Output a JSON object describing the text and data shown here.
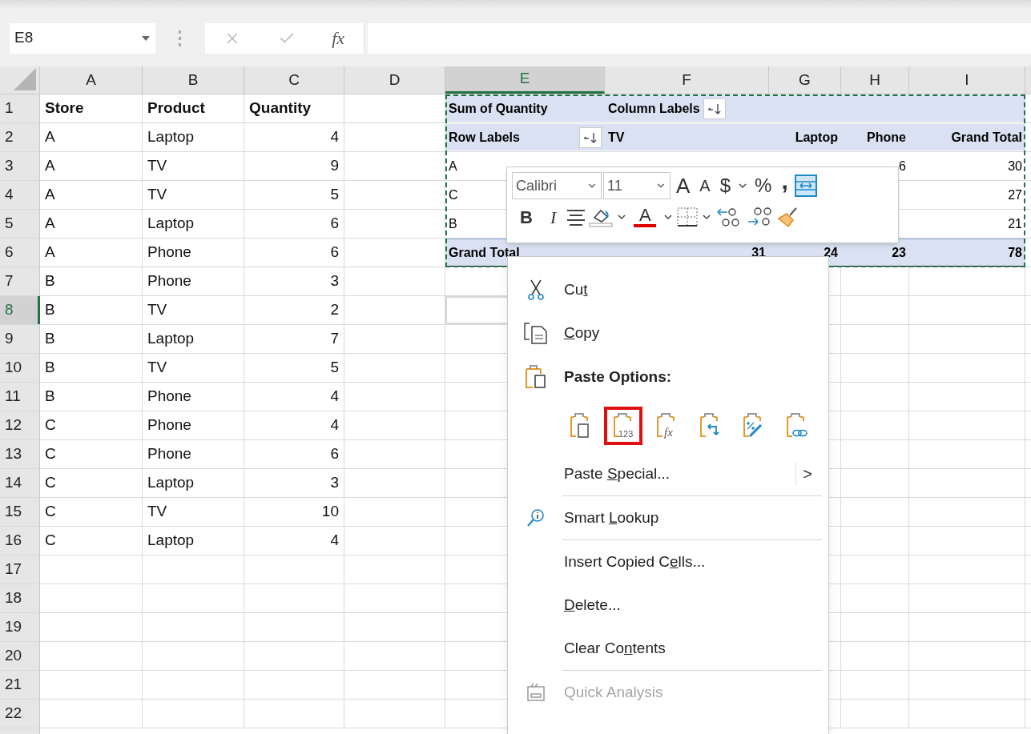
{
  "formula_bar": {
    "name_box": "E8",
    "fx": "fx"
  },
  "columns": [
    {
      "label": "A",
      "selected": false
    },
    {
      "label": "B",
      "selected": false
    },
    {
      "label": "C",
      "selected": false
    },
    {
      "label": "D",
      "selected": false
    },
    {
      "label": "E",
      "selected": true
    },
    {
      "label": "F",
      "selected": false
    },
    {
      "label": "G",
      "selected": false
    },
    {
      "label": "H",
      "selected": false
    },
    {
      "label": "I",
      "selected": false
    }
  ],
  "rows": [
    {
      "number": "1",
      "kind": "header",
      "selected": false,
      "cells": [
        "Store",
        "Product",
        "Quantity"
      ]
    },
    {
      "number": "2",
      "kind": "data",
      "selected": false,
      "cells": [
        "A",
        "Laptop",
        "4"
      ]
    },
    {
      "number": "3",
      "kind": "data",
      "selected": false,
      "cells": [
        "A",
        "TV",
        "9"
      ]
    },
    {
      "number": "4",
      "kind": "data",
      "selected": false,
      "cells": [
        "A",
        "TV",
        "5"
      ]
    },
    {
      "number": "5",
      "kind": "data",
      "selected": false,
      "cells": [
        "A",
        "Laptop",
        "6"
      ]
    },
    {
      "number": "6",
      "kind": "data",
      "selected": false,
      "cells": [
        "A",
        "Phone",
        "6"
      ]
    },
    {
      "number": "7",
      "kind": "data",
      "selected": false,
      "cells": [
        "B",
        "Phone",
        "3"
      ]
    },
    {
      "number": "8",
      "kind": "data",
      "selected": true,
      "cells": [
        "B",
        "TV",
        "2"
      ]
    },
    {
      "number": "9",
      "kind": "data",
      "selected": false,
      "cells": [
        "B",
        "Laptop",
        "7"
      ]
    },
    {
      "number": "10",
      "kind": "data",
      "selected": false,
      "cells": [
        "B",
        "TV",
        "5"
      ]
    },
    {
      "number": "11",
      "kind": "data",
      "selected": false,
      "cells": [
        "B",
        "Phone",
        "4"
      ]
    },
    {
      "number": "12",
      "kind": "data",
      "selected": false,
      "cells": [
        "C",
        "Phone",
        "4"
      ]
    },
    {
      "number": "13",
      "kind": "data",
      "selected": false,
      "cells": [
        "C",
        "Phone",
        "6"
      ]
    },
    {
      "number": "14",
      "kind": "data",
      "selected": false,
      "cells": [
        "C",
        "Laptop",
        "3"
      ]
    },
    {
      "number": "15",
      "kind": "data",
      "selected": false,
      "cells": [
        "C",
        "TV",
        "10"
      ]
    },
    {
      "number": "16",
      "kind": "data",
      "selected": false,
      "cells": [
        "C",
        "Laptop",
        "4"
      ]
    },
    {
      "number": "17",
      "kind": "data",
      "selected": false,
      "cells": []
    },
    {
      "number": "18",
      "kind": "data",
      "selected": false,
      "cells": []
    },
    {
      "number": "19",
      "kind": "data",
      "selected": false,
      "cells": []
    },
    {
      "number": "20",
      "kind": "data",
      "selected": false,
      "cells": []
    },
    {
      "number": "21",
      "kind": "data",
      "selected": false,
      "cells": []
    },
    {
      "number": "22",
      "kind": "data",
      "selected": false,
      "cells": []
    }
  ],
  "pivot": {
    "value_label": "Sum of Quantity",
    "column_labels": "Column Labels",
    "row_labels": "Row Labels",
    "columns": [
      "TV",
      "Laptop",
      "Phone",
      "Grand Total"
    ],
    "rows": [
      {
        "label": "A",
        "phone": "6",
        "grand_total": "30"
      },
      {
        "label": "C",
        "grand_total": "27"
      },
      {
        "label": "B",
        "grand_total": "21"
      }
    ],
    "total": {
      "label": "Grand Total",
      "tv": "31",
      "laptop": "24",
      "phone": "23",
      "grand_total": "78"
    }
  },
  "mini_toolbar": {
    "font": "Calibri",
    "size": "11",
    "row_1": [
      {
        "kind": "grow",
        "glyph": "A"
      },
      {
        "kind": "shrink",
        "glyph": "A"
      },
      {
        "kind": "glyph",
        "glyph": "$"
      },
      {
        "kind": "caret"
      },
      {
        "kind": "glyph",
        "glyph": "%"
      },
      {
        "kind": "comma",
        "glyph": ","
      },
      {
        "kind": "wrap"
      }
    ],
    "row_2": [
      {
        "kind": "bold",
        "glyph": "B"
      },
      {
        "kind": "italic",
        "glyph": "I"
      },
      {
        "kind": "align"
      },
      {
        "kind": "fill"
      },
      {
        "kind": "caret"
      },
      {
        "kind": "font_color",
        "glyph": "A"
      },
      {
        "kind": "caret"
      },
      {
        "kind": "borders"
      },
      {
        "kind": "caret"
      },
      {
        "kind": "dec_left"
      },
      {
        "kind": "dec_right"
      },
      {
        "kind": "painter"
      }
    ]
  },
  "context_menu": [
    {
      "kind": "cut",
      "label": {
        "before": "Cu",
        "key": "t"
      },
      "disabled": false
    },
    {
      "kind": "copy",
      "label": {
        "key": "C",
        "after": "opy"
      },
      "disabled": false
    },
    {
      "kind": "paste_options",
      "heading": "Paste Options:",
      "options": [
        {
          "kind": "paste",
          "selected": false
        },
        {
          "kind": "values",
          "text": "123",
          "selected": true
        },
        {
          "kind": "formulas",
          "text": "fx",
          "selected": false
        },
        {
          "kind": "transpose",
          "selected": false
        },
        {
          "kind": "formatting",
          "selected": false
        },
        {
          "kind": "link",
          "selected": false
        }
      ]
    },
    {
      "kind": "submenu",
      "label": {
        "before": "Paste ",
        "key": "S",
        "after": "pecial..."
      },
      "arrow": ">",
      "disabled": false
    },
    {
      "kind": "separator"
    },
    {
      "kind": "smart_lookup",
      "label": {
        "before": "Smart ",
        "key": "L",
        "after": "ookup"
      },
      "disabled": false
    },
    {
      "kind": "separator"
    },
    {
      "kind": "plain",
      "label": {
        "before": "Insert Copied C",
        "key": "e",
        "after": "lls..."
      },
      "disabled": false
    },
    {
      "kind": "plain",
      "label": {
        "key": "D",
        "after": "elete..."
      },
      "disabled": false
    },
    {
      "kind": "plain",
      "label": {
        "before": "Clear Co",
        "key": "n",
        "after": "tents"
      },
      "disabled": false
    },
    {
      "kind": "separator"
    },
    {
      "kind": "quick_analysis",
      "label": {
        "before": "Quick Analysis"
      },
      "disabled": true
    }
  ]
}
